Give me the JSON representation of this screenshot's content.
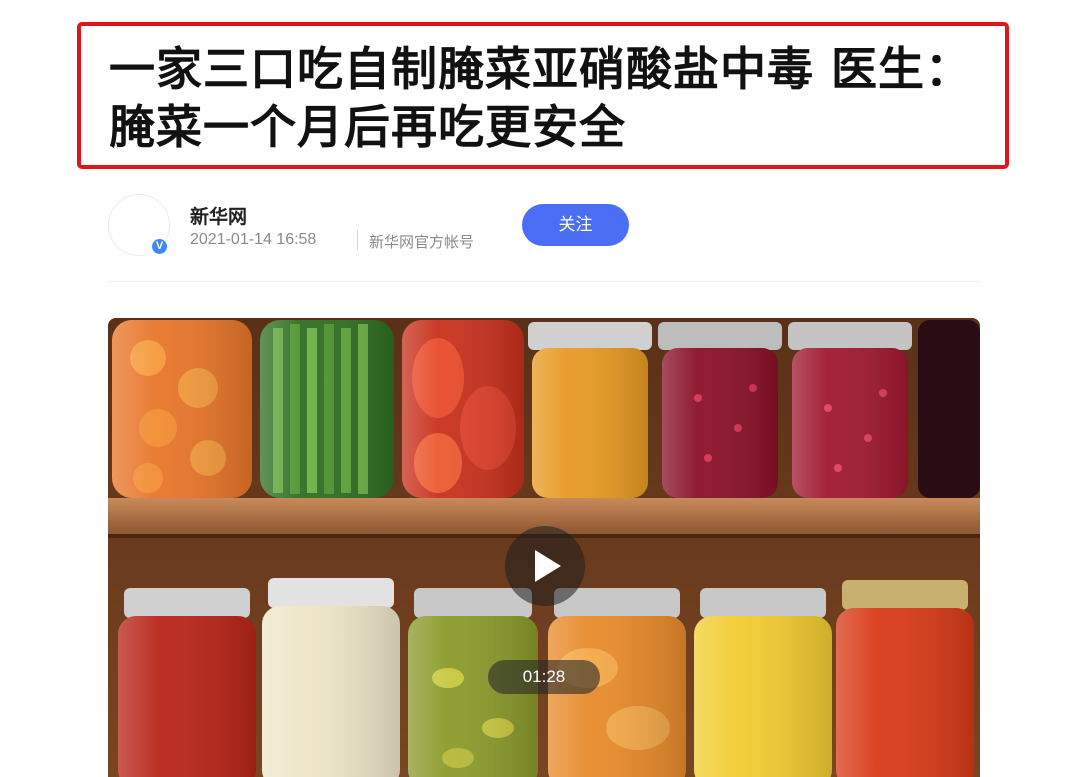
{
  "article": {
    "headline": "一家三口吃自制腌菜亚硝酸盐中毒 医生：腌菜一个月后再吃更安全"
  },
  "author": {
    "name": "新华网",
    "timestamp": "2021-01-14 16:58",
    "account_type": "新华网官方帐号",
    "verified_mark": "V",
    "follow_label": "关注"
  },
  "video": {
    "duration": "01:28"
  },
  "colors": {
    "headline_border": "#e0161d",
    "follow_button": "#4b6ef5",
    "verified_badge": "#3d8af7"
  },
  "icons": [
    "verified-badge-icon",
    "play-icon"
  ]
}
